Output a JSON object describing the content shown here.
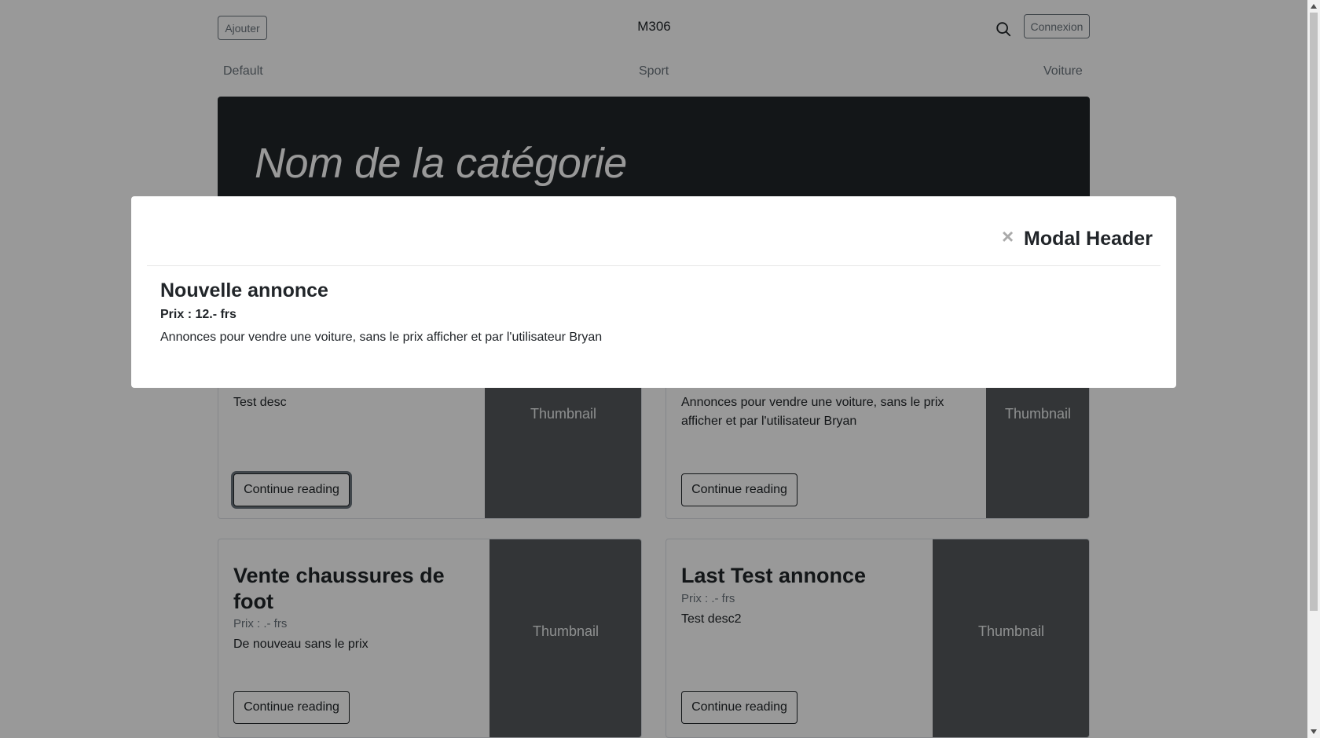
{
  "header": {
    "add_label": "Ajouter",
    "site_title": "M306",
    "search_icon": "search-icon",
    "login_label": "Connexion"
  },
  "nav": {
    "items": [
      {
        "label": "Default"
      },
      {
        "label": "Sport"
      },
      {
        "label": "Voiture"
      }
    ]
  },
  "jumbotron": {
    "title": "Nom de la catégorie"
  },
  "cards": [
    {
      "title": "",
      "price": "",
      "desc": "Test desc",
      "button": "Continue reading",
      "thumbnail": "Thumbnail"
    },
    {
      "title": "",
      "price": "",
      "desc": "Annonces pour vendre une voiture, sans le prix afficher et par l'utilisateur Bryan",
      "button": "Continue reading",
      "thumbnail": "Thumbnail"
    },
    {
      "title": "Vente chaussures de foot",
      "price": "Prix : .- frs",
      "desc": "De nouveau sans le prix",
      "button": "Continue reading",
      "thumbnail": "Thumbnail"
    },
    {
      "title": "Last Test annonce",
      "price": "Prix : .- frs",
      "desc": "Test desc2",
      "button": "Continue reading",
      "thumbnail": "Thumbnail"
    }
  ],
  "modal": {
    "close_symbol": "×",
    "header_title": "Modal Header",
    "ad_title": "Nouvelle annonce",
    "ad_price": "Prix : 12.- frs",
    "ad_desc": "Annonces pour vendre une voiture, sans le prix afficher et par l'utilisateur Bryan"
  },
  "colors": {
    "dark": "#212529",
    "thumbnail": "#55595c",
    "muted": "#6c757d"
  }
}
